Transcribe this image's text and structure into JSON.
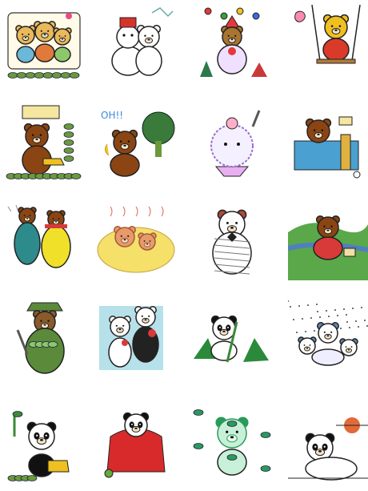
{
  "gallery": {
    "rows": [
      [
        {
          "name": "bears-family-frame-icon",
          "colors": [
            "#e9b95a",
            "#7a4a2a"
          ]
        },
        {
          "name": "snowman-bear-icon",
          "colors": [
            "#ffffff",
            "#d8332a"
          ]
        },
        {
          "name": "clown-bear-juggling-icon",
          "colors": [
            "#a8752f",
            "#e03a3a"
          ]
        },
        {
          "name": "bear-on-swing-icon",
          "colors": [
            "#f0c020",
            "#d93a2a"
          ]
        }
      ],
      [
        {
          "name": "bear-watering-plants-icon",
          "colors": [
            "#8b4513",
            "#6a9a3a"
          ]
        },
        {
          "name": "bear-with-broccoli-icon",
          "colors": [
            "#8b4513",
            "#3a7a3a"
          ],
          "caption": "OH!!"
        },
        {
          "name": "hairy-creature-dessert-icon",
          "colors": [
            "#9b6bd0",
            "#ffb0c8"
          ]
        },
        {
          "name": "bear-in-bathtub-icon",
          "colors": [
            "#8b4513",
            "#4aa0d0"
          ]
        }
      ],
      [
        {
          "name": "two-bears-winter-coats-icon",
          "colors": [
            "#2e8b8b",
            "#f0e02a"
          ]
        },
        {
          "name": "bears-in-hot-spring-icon",
          "colors": [
            "#f5e06a",
            "#e89a6a"
          ]
        },
        {
          "name": "mummy-bear-icon",
          "colors": [
            "#ffffff",
            "#b0483a"
          ]
        },
        {
          "name": "bear-picnic-meadow-icon",
          "colors": [
            "#5aa84a",
            "#4f7fc0"
          ]
        }
      ],
      [
        {
          "name": "soldier-bear-icon",
          "colors": [
            "#5a8a3a",
            "#8b5a2b"
          ]
        },
        {
          "name": "white-bears-with-flowers-icon",
          "colors": [
            "#7ac8d8",
            "#d83a3a"
          ]
        },
        {
          "name": "panda-with-bamboo-icon",
          "colors": [
            "#111111",
            "#2a8a3a"
          ]
        },
        {
          "name": "pandas-in-snow-icon",
          "colors": [
            "#5a88b8",
            "#ffffff"
          ]
        }
      ],
      [
        {
          "name": "panda-watering-can-icon",
          "colors": [
            "#111111",
            "#f0c020"
          ]
        },
        {
          "name": "panda-in-red-blanket-icon",
          "colors": [
            "#d82a2a",
            "#111111"
          ]
        },
        {
          "name": "green-panda-bamboo-icon",
          "colors": [
            "#2a9a5a",
            "#c8f0d8"
          ]
        },
        {
          "name": "panda-sunset-icon",
          "colors": [
            "#111111",
            "#e06a3a"
          ]
        }
      ]
    ]
  }
}
